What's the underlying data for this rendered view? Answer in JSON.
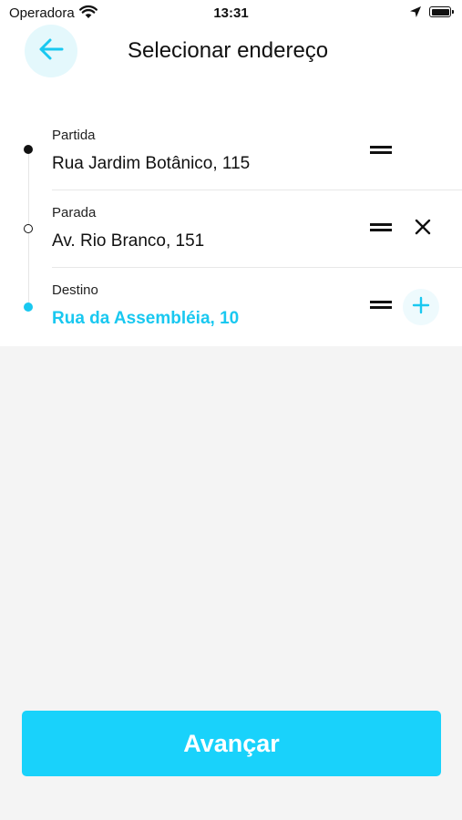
{
  "status_bar": {
    "carrier": "Operadora",
    "time": "13:31",
    "wifi_icon": "wifi-icon",
    "location_icon": "location-arrow-icon",
    "battery_icon": "battery-full-icon"
  },
  "header": {
    "back_icon": "arrow-left-icon",
    "title": "Selecionar endereço"
  },
  "stops": [
    {
      "label": "Partida",
      "value": "Rua Jardim Botânico, 115",
      "marker": "filled-dot",
      "action": null
    },
    {
      "label": "Parada",
      "value": "Av. Rio Branco, 151",
      "marker": "hollow-dot",
      "action": "close-icon"
    },
    {
      "label": "Destino",
      "value": "Rua da Assembléia, 10",
      "marker": "accent-dot",
      "action": "plus-icon"
    }
  ],
  "footer": {
    "advance_label": "Avançar"
  },
  "colors": {
    "accent": "#19d2fb",
    "accent_text": "#19c8f0",
    "back_button_bg": "#e4f8fc",
    "page_bg": "#f4f4f4"
  }
}
